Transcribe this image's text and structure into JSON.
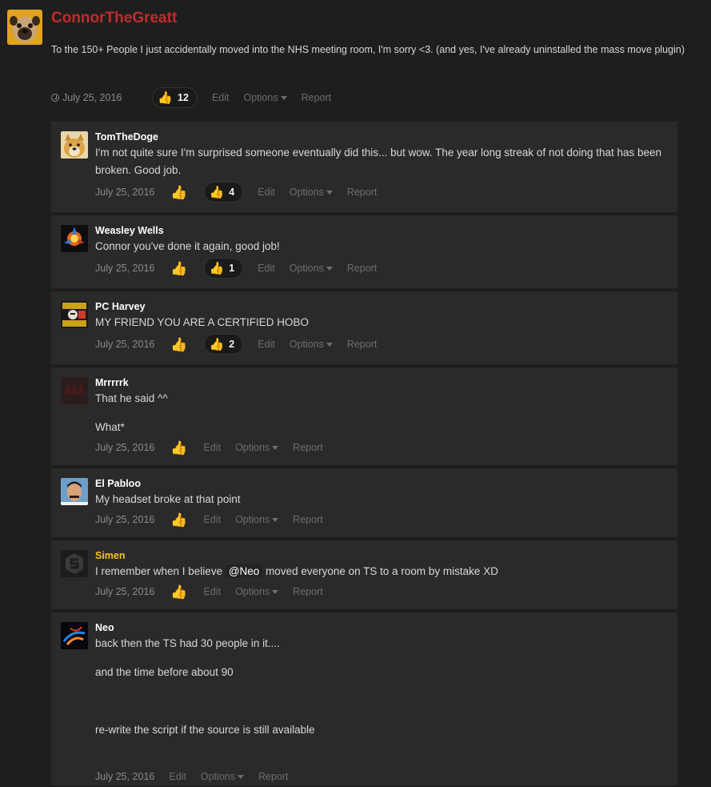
{
  "post": {
    "author": "ConnorTheGreatt",
    "body": "To the 150+ People I just accidentally moved into the NHS meeting room, I'm sorry <3. (and yes, I've already uninstalled the mass move plugin)",
    "date": "July 25, 2016",
    "reaction_count": "12",
    "edit": "Edit",
    "options": "Options",
    "report": "Report"
  },
  "comments": [
    {
      "author": "TomTheDoge",
      "author_color": "#c42b2b",
      "avatar_icon": "doge-avatar",
      "lines": [
        "I'm not quite sure I'm surprised someone eventually did this... but wow. The year long streak of not doing that has been broken. Good job."
      ],
      "date": "July 25, 2016",
      "reaction_count": "4",
      "edit": "Edit",
      "options": "Options",
      "report": "Report"
    },
    {
      "author": "Weasley Wells",
      "author_color": "#ffffff",
      "avatar_icon": "fire-avatar",
      "lines": [
        "Connor you've done it again, good job!"
      ],
      "date": "July 25, 2016",
      "reaction_count": "1",
      "edit": "Edit",
      "options": "Options",
      "report": "Report"
    },
    {
      "author": "PC Harvey",
      "author_color": "#ffffff",
      "avatar_icon": "poster-avatar",
      "lines": [
        "MY FRIEND YOU ARE A CERTIFIED HOBO"
      ],
      "date": "July 25, 2016",
      "reaction_count": "2",
      "edit": "Edit",
      "options": "Options",
      "report": "Report"
    },
    {
      "author": "Mrrrrrk",
      "author_color": "#ffffff",
      "avatar_icon": "dark-avatar",
      "lines": [
        "That he said ^^",
        "What*"
      ],
      "date": "July 25, 2016",
      "edit": "Edit",
      "options": "Options",
      "report": "Report"
    },
    {
      "author": "El Pabloo",
      "author_color": "#ffffff",
      "avatar_icon": "portrait-avatar",
      "lines": [
        "My headset broke at that point"
      ],
      "date": "July 25, 2016",
      "edit": "Edit",
      "options": "Options",
      "report": "Report"
    },
    {
      "author": "Simen",
      "author_color": "#f5c518",
      "avatar_icon": "s-logo-avatar",
      "text_before": "I remember when I believe ",
      "mention": "@Neo",
      "text_after": " moved everyone on TS to a room by mistake XD",
      "date": "July 25, 2016",
      "edit": "Edit",
      "options": "Options",
      "report": "Report"
    },
    {
      "author": "Neo",
      "author_color": "#ffffff",
      "avatar_icon": "swirl-avatar",
      "lines": [
        "back then the TS had 30 people in it....",
        "and the time before about 90",
        "re-write the script if the source is still available"
      ],
      "date": "July 25, 2016",
      "edit": "Edit",
      "options": "Options",
      "report": "Report"
    }
  ]
}
